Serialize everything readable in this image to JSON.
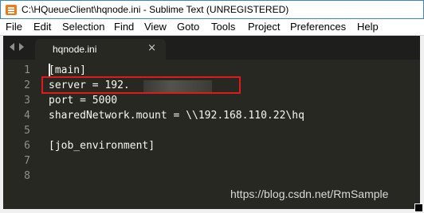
{
  "window": {
    "title": "C:\\HQueueClient\\hqnode.ini - Sublime Text (UNREGISTERED)"
  },
  "menu": {
    "items": [
      "File",
      "Edit",
      "Selection",
      "Find",
      "View",
      "Goto",
      "Tools",
      "Project",
      "Preferences",
      "Help"
    ]
  },
  "tabs": [
    {
      "label": "hqnode.ini",
      "close": "×"
    }
  ],
  "editor": {
    "lines": [
      {
        "num": "1",
        "text": "[main]"
      },
      {
        "num": "2",
        "text": "server = 192."
      },
      {
        "num": "3",
        "text": "port = 5000"
      },
      {
        "num": "4",
        "text": "sharedNetwork.mount = \\\\192.168.110.22\\hq"
      },
      {
        "num": "5",
        "text": ""
      },
      {
        "num": "6",
        "text": "[job_environment]"
      },
      {
        "num": "7",
        "text": ""
      },
      {
        "num": "8",
        "text": ""
      }
    ]
  },
  "watermark": "https://blog.csdn.net/RmSample",
  "colors": {
    "editor_bg": "#272822",
    "highlight_border": "#e0191d",
    "text": "#f8f8f2",
    "line_number": "#90908a"
  },
  "icons": {
    "app": "sublime-text-icon",
    "nav_left": "tab-nav-left-icon",
    "nav_right": "tab-nav-right-icon",
    "close": "close-icon"
  }
}
